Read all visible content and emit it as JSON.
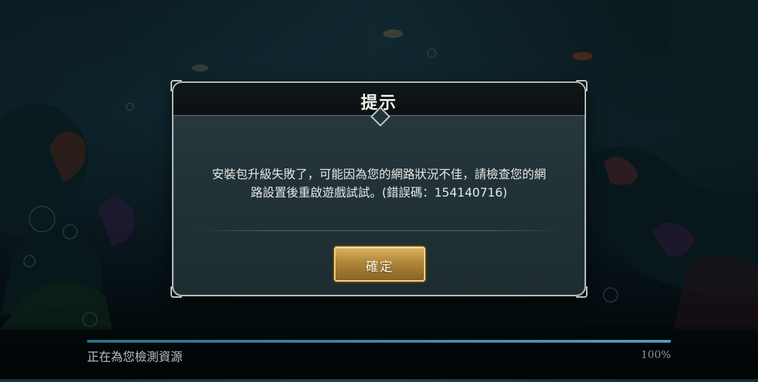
{
  "dialog": {
    "title": "提示",
    "message_line1": "安裝包升級失敗了，可能因為您的網路狀況不佳，請檢查您的網",
    "message_line2": "路設置後重啟遊戲試試。(錯誤碼：154140716)",
    "confirm_label": "確定"
  },
  "loading": {
    "status_text": "正在為您檢測資源",
    "percent_text": "100%",
    "progress": 1.0
  },
  "colors": {
    "accent_gold": "#c9a24f",
    "progress_blue": "#4d9fb8"
  }
}
